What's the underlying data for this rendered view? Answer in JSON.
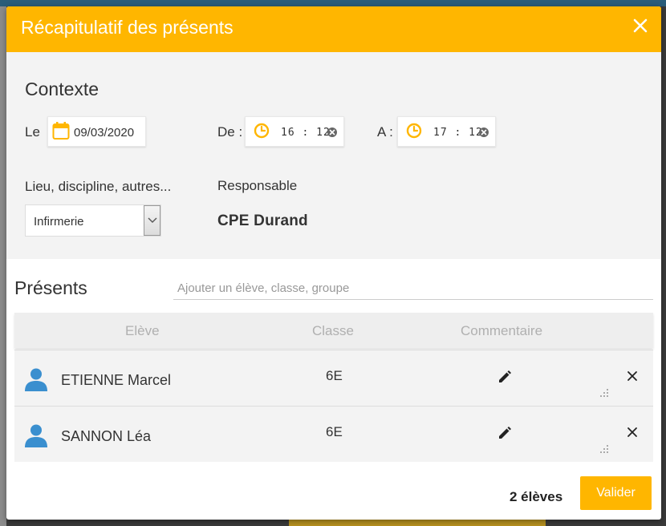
{
  "dialog": {
    "title": "Récapitulatif des présents"
  },
  "context": {
    "title": "Contexte",
    "date_label": "Le",
    "date_value": "09/03/2020",
    "from_label": "De :",
    "from_time": "16 : 12",
    "to_label": "A :",
    "to_time": "17 : 12",
    "place_label": "Lieu, discipline, autres...",
    "place_value": "Infirmerie",
    "responsible_label": "Responsable",
    "responsible_value": "CPE Durand"
  },
  "presents": {
    "title": "Présents",
    "search_placeholder": "Ajouter un élève, classe, groupe",
    "columns": [
      "Elève",
      "Classe",
      "Commentaire"
    ],
    "rows": [
      {
        "name": "ETIENNE Marcel",
        "classe": "6E"
      },
      {
        "name": "SANNON Léa",
        "classe": "6E"
      }
    ]
  },
  "footer": {
    "count": "2 élèves",
    "submit_label": "Valider"
  },
  "colors": {
    "accent": "#ffb600",
    "avatar": "#3a8fcf"
  }
}
